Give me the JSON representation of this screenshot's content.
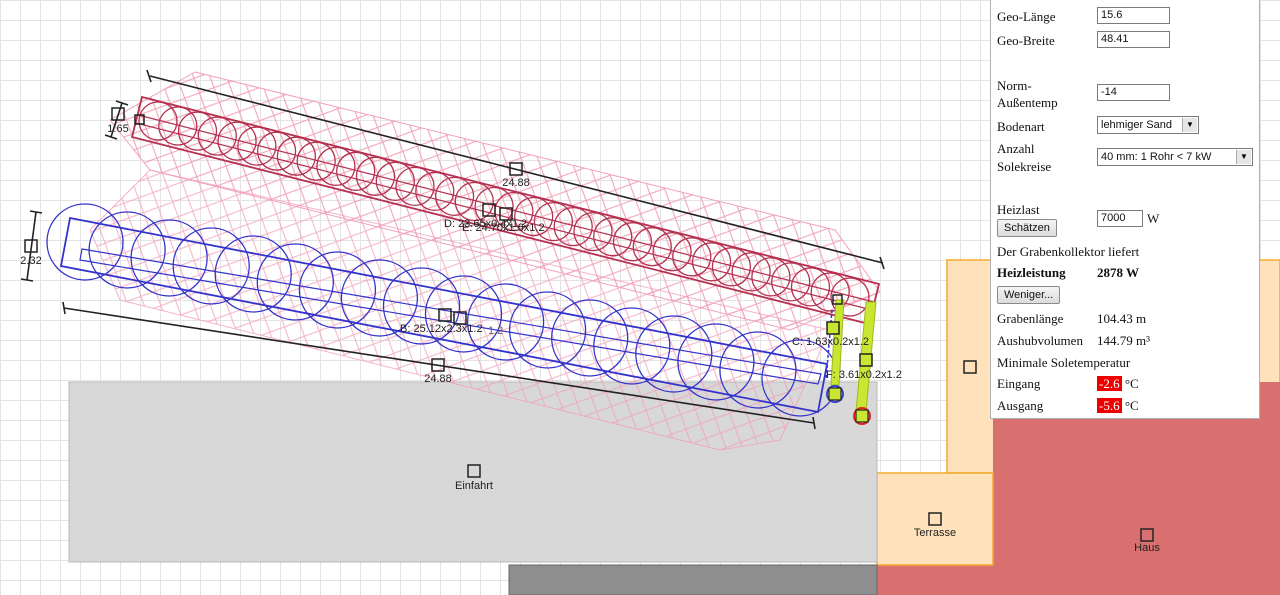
{
  "map": {
    "areas": {
      "einfahrt": "Einfahrt",
      "terrasse": "Terrasse",
      "haus": "Haus"
    },
    "dimensions": {
      "top_length": "24.88",
      "bottom_length": "24.88",
      "top_width": "1.65",
      "left_width": "2.32"
    },
    "trenches": {
      "b": "B: 25.12x2.3x1.2",
      "b_ghost": "1.2",
      "c": "C: 1.63x0.2x1.2",
      "d": "D: 23.65x0.4x1.2",
      "e": "E: 24.70x1.6x1.2",
      "f": "F: 3.61x0.2x1.2"
    },
    "colors": {
      "trench_upper": "#b5314f",
      "trench_lower": "#3333cc",
      "ghost": "#f2a0b8",
      "connector": "#c8e632",
      "terrace_fill": "#ffe2bb",
      "terrace_border": "#f0ab2c",
      "house_fill": "#d87070",
      "driveway_fill": "#d8d8d8",
      "inlet": "#3344cc",
      "outlet": "#dd2222"
    }
  },
  "panel": {
    "geo_laenge_label": "Geo-Länge",
    "geo_laenge_value": "15.6",
    "geo_breite_label": "Geo-Breite",
    "geo_breite_value": "48.41",
    "norm_label_1": "Norm-",
    "norm_label_2": "Außentemp",
    "norm_value": "-14",
    "bodenart_label": "Bodenart",
    "bodenart_value": "lehmiger Sand",
    "anzahl_label_1": "Anzahl",
    "anzahl_label_2": "Solekreise",
    "anzahl_value": "40 mm: 1 Rohr  < 7 kW",
    "heizlast_label": "Heizlast",
    "schaetzen_label": "Schätzen",
    "heizlast_value": "7000",
    "heizlast_unit": "W",
    "liefert_text": "Der Grabenkollektor liefert",
    "heizleistung_label": "Heizleistung",
    "heizleistung_value": "2878 W",
    "weniger_label": "Weniger...",
    "grabenlaenge_label": "Grabenlänge",
    "grabenlaenge_value": "104.43 m",
    "aushub_label": "Aushubvolumen",
    "aushub_value": "144.79 m³",
    "minimale_text": "Minimale Soletemperatur",
    "eingang_label": "Eingang",
    "eingang_value": "-2.6",
    "ausgang_label": "Ausgang",
    "ausgang_value": "-5.6",
    "temp_unit": "°C",
    "select_arrow": "▼"
  }
}
